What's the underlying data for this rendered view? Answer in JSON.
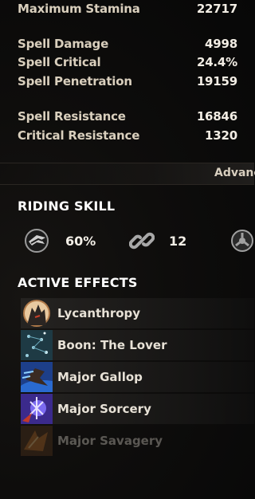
{
  "stats_top": {
    "label": "Maximum Stamina",
    "value": "22717"
  },
  "spell_stats": [
    {
      "label": "Spell Damage",
      "value": "4998"
    },
    {
      "label": "Spell Critical",
      "value": "24.4%"
    },
    {
      "label": "Spell Penetration",
      "value": "19159"
    }
  ],
  "resist_stats": [
    {
      "label": "Spell Resistance",
      "value": "16846"
    },
    {
      "label": "Critical Resistance",
      "value": "1320"
    }
  ],
  "advanced_label": "Advanc",
  "riding": {
    "title": "RIDING SKILL",
    "speed": "60%",
    "stamina": "12",
    "speed_icon": "horse-speed-icon",
    "stamina_icon": "chain-link-icon",
    "capacity_icon": "bag-capacity-icon"
  },
  "effects": {
    "title": "ACTIVE EFFECTS",
    "items": [
      {
        "label": "Lycanthropy",
        "icon": "werewolf-icon"
      },
      {
        "label": "Boon: The Lover",
        "icon": "mundus-stone-icon"
      },
      {
        "label": "Major Gallop",
        "icon": "gallop-icon"
      },
      {
        "label": "Major Sorcery",
        "icon": "sorcery-icon"
      },
      {
        "label": "Major Savagery",
        "icon": "savagery-icon"
      }
    ]
  },
  "colors": {
    "text": "#ddd4c4",
    "value": "#f2ede4",
    "heading": "#ffffff"
  }
}
